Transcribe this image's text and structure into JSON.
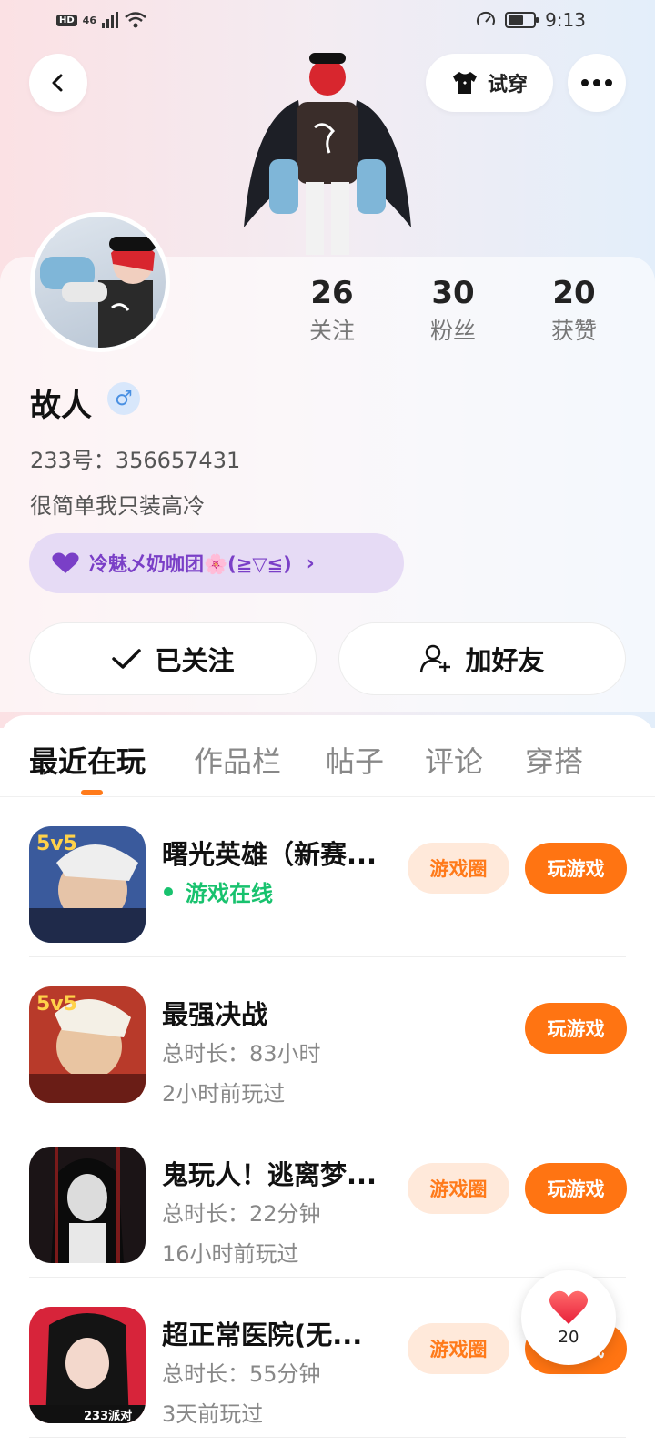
{
  "status_bar": {
    "network": "46",
    "time": "9:13"
  },
  "header": {
    "tryon_label": "试穿"
  },
  "profile": {
    "name": "故人",
    "gender_symbol": "♂",
    "uid_text": "233号：356657431",
    "bio": "很简单我只装高冷",
    "club_label": "冷魅乄奶咖团🌸(≧▽≦)",
    "stats": [
      {
        "num": "26",
        "label": "关注"
      },
      {
        "num": "30",
        "label": "粉丝"
      },
      {
        "num": "20",
        "label": "获赞"
      }
    ],
    "follow_label": "已关注",
    "add_friend_label": "加好友"
  },
  "tabs": [
    "最近在玩",
    "作品栏",
    "帖子",
    "评论",
    "穿搭"
  ],
  "games": [
    {
      "title": "曙光英雄（新赛...",
      "status": "游戏在线",
      "line1": "",
      "line2": "",
      "circle": "游戏圈",
      "play": "玩游戏",
      "badge": "5v5"
    },
    {
      "title": "最强决战",
      "status": "",
      "line1": "总时长：83小时",
      "line2": "2小时前玩过",
      "circle": "",
      "play": "玩游戏",
      "badge": "5v5"
    },
    {
      "title": "鬼玩人！逃离梦...",
      "status": "",
      "line1": "总时长：22分钟",
      "line2": "16小时前玩过",
      "circle": "游戏圈",
      "play": "玩游戏",
      "badge": ""
    },
    {
      "title": "超正常医院(无...",
      "status": "",
      "line1": "总时长：55分钟",
      "line2": "3天前玩过",
      "circle": "游戏圈",
      "play": "玩游戏",
      "badge": "233派对"
    }
  ],
  "floating_like": {
    "count": "20"
  },
  "colors": {
    "accent": "#ff7412",
    "accent_light": "#ffe9da",
    "online_green": "#18c26e",
    "club_purple": "#7a3fc7"
  }
}
